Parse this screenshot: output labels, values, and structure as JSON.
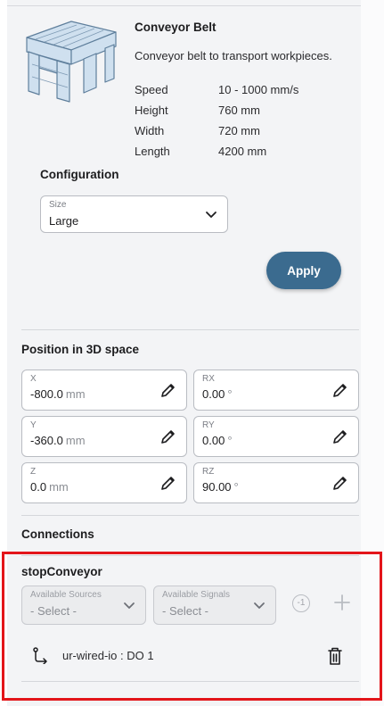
{
  "product": {
    "icon": "conveyor-belt-image",
    "title": "Conveyor Belt",
    "description": "Conveyor belt to transport workpieces.",
    "specs": [
      {
        "label": "Speed",
        "value": "10 - 1000 mm/s"
      },
      {
        "label": "Height",
        "value": "760 mm"
      },
      {
        "label": "Width",
        "value": "720 mm"
      },
      {
        "label": "Length",
        "value": "4200 mm"
      }
    ]
  },
  "configuration": {
    "title": "Configuration",
    "size_caption": "Size",
    "size_value": "Large",
    "apply_label": "Apply"
  },
  "position": {
    "title": "Position in 3D space",
    "fields": [
      {
        "caption": "X",
        "value": "-800.0",
        "unit": "mm"
      },
      {
        "caption": "RX",
        "value": "0.00",
        "unit": "°"
      },
      {
        "caption": "Y",
        "value": "-360.0",
        "unit": "mm"
      },
      {
        "caption": "RY",
        "value": "0.00",
        "unit": "°"
      },
      {
        "caption": "Z",
        "value": "0.0",
        "unit": "mm"
      },
      {
        "caption": "RZ",
        "value": "90.00",
        "unit": "°"
      }
    ]
  },
  "connections": {
    "title": "Connections",
    "signal_name": "stopConveyor",
    "sources_caption": "Available Sources",
    "sources_value": "- Select -",
    "signals_caption": "Available Signals",
    "signals_value": "- Select -",
    "count_badge": "-1",
    "connection_text": "ur-wired-io : DO 1"
  },
  "colors": {
    "accent": "#3b6b8f",
    "highlight": "#e3151a"
  }
}
